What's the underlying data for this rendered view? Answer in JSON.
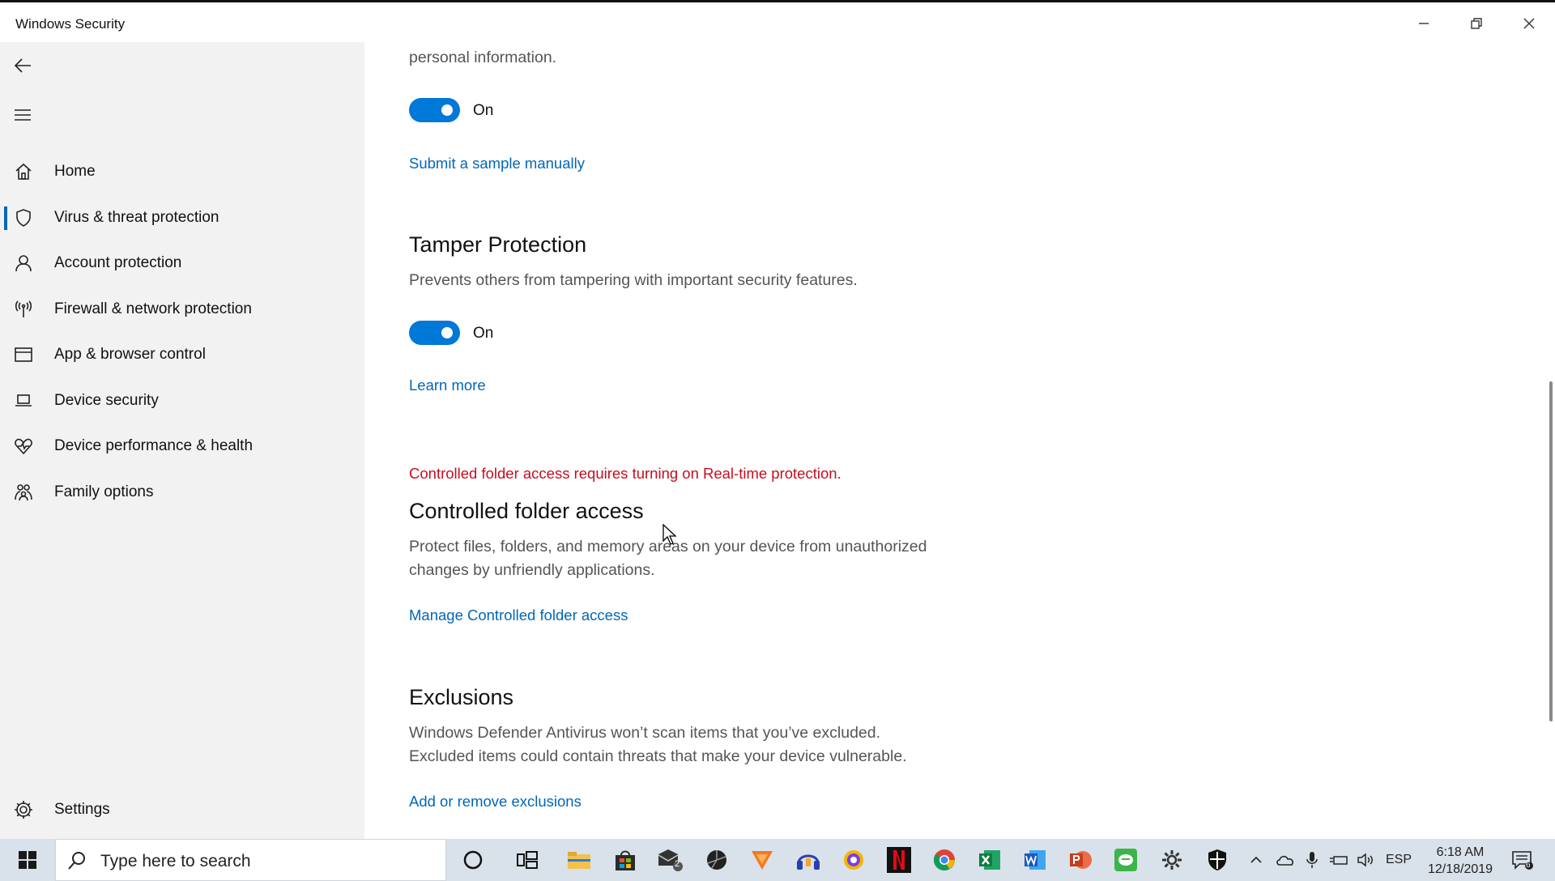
{
  "window": {
    "title": "Windows Security"
  },
  "sidebar": {
    "items": [
      {
        "label": "Home",
        "icon": "home-icon"
      },
      {
        "label": "Virus & threat protection",
        "icon": "shield-icon",
        "active": true
      },
      {
        "label": "Account protection",
        "icon": "person-icon"
      },
      {
        "label": "Firewall & network protection",
        "icon": "antenna-icon"
      },
      {
        "label": "App & browser control",
        "icon": "app-window-icon"
      },
      {
        "label": "Device security",
        "icon": "laptop-icon"
      },
      {
        "label": "Device performance & health",
        "icon": "heart-icon"
      },
      {
        "label": "Family options",
        "icon": "family-icon"
      }
    ],
    "settings_label": "Settings"
  },
  "main": {
    "partial_text": "personal information.",
    "sample_toggle": {
      "state": "On"
    },
    "submit_sample_link": "Submit a sample manually",
    "tamper": {
      "heading": "Tamper Protection",
      "description": "Prevents others from tampering with important security features.",
      "toggle_state": "On",
      "learn_more": "Learn more"
    },
    "cfa": {
      "warning": "Controlled folder access requires turning on Real-time protection.",
      "heading": "Controlled folder access",
      "description_line1": "Protect files, folders, and memory areas on your device from unauthorized",
      "description_line2": "changes by unfriendly applications.",
      "manage_link": "Manage Controlled folder access"
    },
    "exclusions": {
      "heading": "Exclusions",
      "description_line1": "Windows Defender Antivirus won’t scan items that you’ve excluded.",
      "description_line2": "Excluded items could contain threats that make your device vulnerable.",
      "link": "Add or remove exclusions"
    }
  },
  "taskbar": {
    "search_placeholder": "Type here to search",
    "mail_badge": "2",
    "language": "ESP",
    "time": "6:18 AM",
    "date": "12/18/2019",
    "notification_count": "6"
  },
  "colors": {
    "accent": "#0078d7",
    "link": "#0067b8",
    "warning": "#c50f1f",
    "sidebar_bg": "#f2f2f2",
    "taskbar_bg": "#d9e1ea"
  }
}
